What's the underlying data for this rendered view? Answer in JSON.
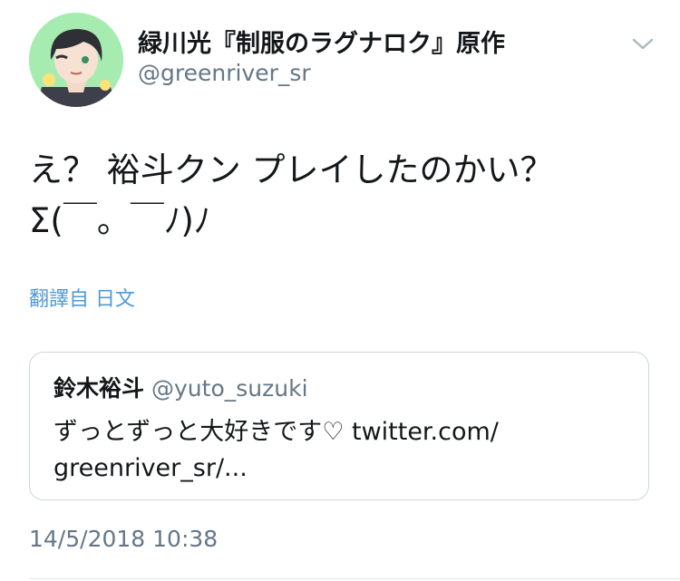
{
  "user": {
    "display_name": "緑川光『制服のラグナロク』原作",
    "handle": "@greenriver_sr",
    "avatar_icon": "avatar-illustration"
  },
  "tweet": {
    "text": "え？ 裕斗クン プレイしたのかい？\nΣ(￣。￣ﾉ)ﾉ",
    "translate_label": "翻譯自 日文",
    "timestamp": "14/5/2018 10:38"
  },
  "quote": {
    "name": "鈴木裕斗",
    "handle": "@yuto_suzuki",
    "text": "ずっとずっと大好きです♡ twitter.com/\ngreenriver_sr/..."
  },
  "icons": {
    "menu": "chevron-down-icon"
  },
  "colors": {
    "avatar_bg": "#9be7a7",
    "link": "#4f9ad6",
    "secondary_text": "#657786",
    "border": "#ccd6dd"
  }
}
